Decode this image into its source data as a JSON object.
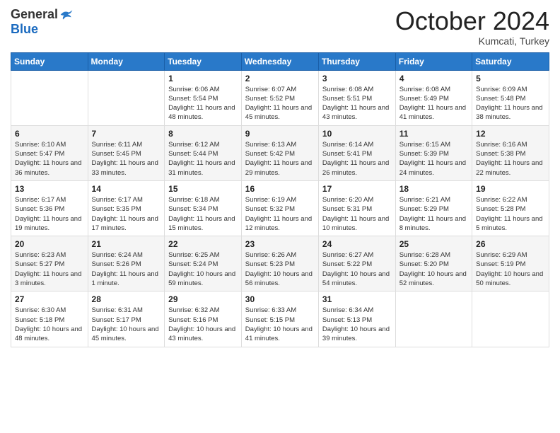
{
  "logo": {
    "general": "General",
    "blue": "Blue"
  },
  "header": {
    "month": "October 2024",
    "location": "Kumcati, Turkey"
  },
  "weekdays": [
    "Sunday",
    "Monday",
    "Tuesday",
    "Wednesday",
    "Thursday",
    "Friday",
    "Saturday"
  ],
  "weeks": [
    [
      {
        "day": null,
        "info": null
      },
      {
        "day": null,
        "info": null
      },
      {
        "day": "1",
        "sunrise": "Sunrise: 6:06 AM",
        "sunset": "Sunset: 5:54 PM",
        "daylight": "Daylight: 11 hours and 48 minutes."
      },
      {
        "day": "2",
        "sunrise": "Sunrise: 6:07 AM",
        "sunset": "Sunset: 5:52 PM",
        "daylight": "Daylight: 11 hours and 45 minutes."
      },
      {
        "day": "3",
        "sunrise": "Sunrise: 6:08 AM",
        "sunset": "Sunset: 5:51 PM",
        "daylight": "Daylight: 11 hours and 43 minutes."
      },
      {
        "day": "4",
        "sunrise": "Sunrise: 6:08 AM",
        "sunset": "Sunset: 5:49 PM",
        "daylight": "Daylight: 11 hours and 41 minutes."
      },
      {
        "day": "5",
        "sunrise": "Sunrise: 6:09 AM",
        "sunset": "Sunset: 5:48 PM",
        "daylight": "Daylight: 11 hours and 38 minutes."
      }
    ],
    [
      {
        "day": "6",
        "sunrise": "Sunrise: 6:10 AM",
        "sunset": "Sunset: 5:47 PM",
        "daylight": "Daylight: 11 hours and 36 minutes."
      },
      {
        "day": "7",
        "sunrise": "Sunrise: 6:11 AM",
        "sunset": "Sunset: 5:45 PM",
        "daylight": "Daylight: 11 hours and 33 minutes."
      },
      {
        "day": "8",
        "sunrise": "Sunrise: 6:12 AM",
        "sunset": "Sunset: 5:44 PM",
        "daylight": "Daylight: 11 hours and 31 minutes."
      },
      {
        "day": "9",
        "sunrise": "Sunrise: 6:13 AM",
        "sunset": "Sunset: 5:42 PM",
        "daylight": "Daylight: 11 hours and 29 minutes."
      },
      {
        "day": "10",
        "sunrise": "Sunrise: 6:14 AM",
        "sunset": "Sunset: 5:41 PM",
        "daylight": "Daylight: 11 hours and 26 minutes."
      },
      {
        "day": "11",
        "sunrise": "Sunrise: 6:15 AM",
        "sunset": "Sunset: 5:39 PM",
        "daylight": "Daylight: 11 hours and 24 minutes."
      },
      {
        "day": "12",
        "sunrise": "Sunrise: 6:16 AM",
        "sunset": "Sunset: 5:38 PM",
        "daylight": "Daylight: 11 hours and 22 minutes."
      }
    ],
    [
      {
        "day": "13",
        "sunrise": "Sunrise: 6:17 AM",
        "sunset": "Sunset: 5:36 PM",
        "daylight": "Daylight: 11 hours and 19 minutes."
      },
      {
        "day": "14",
        "sunrise": "Sunrise: 6:17 AM",
        "sunset": "Sunset: 5:35 PM",
        "daylight": "Daylight: 11 hours and 17 minutes."
      },
      {
        "day": "15",
        "sunrise": "Sunrise: 6:18 AM",
        "sunset": "Sunset: 5:34 PM",
        "daylight": "Daylight: 11 hours and 15 minutes."
      },
      {
        "day": "16",
        "sunrise": "Sunrise: 6:19 AM",
        "sunset": "Sunset: 5:32 PM",
        "daylight": "Daylight: 11 hours and 12 minutes."
      },
      {
        "day": "17",
        "sunrise": "Sunrise: 6:20 AM",
        "sunset": "Sunset: 5:31 PM",
        "daylight": "Daylight: 11 hours and 10 minutes."
      },
      {
        "day": "18",
        "sunrise": "Sunrise: 6:21 AM",
        "sunset": "Sunset: 5:29 PM",
        "daylight": "Daylight: 11 hours and 8 minutes."
      },
      {
        "day": "19",
        "sunrise": "Sunrise: 6:22 AM",
        "sunset": "Sunset: 5:28 PM",
        "daylight": "Daylight: 11 hours and 5 minutes."
      }
    ],
    [
      {
        "day": "20",
        "sunrise": "Sunrise: 6:23 AM",
        "sunset": "Sunset: 5:27 PM",
        "daylight": "Daylight: 11 hours and 3 minutes."
      },
      {
        "day": "21",
        "sunrise": "Sunrise: 6:24 AM",
        "sunset": "Sunset: 5:26 PM",
        "daylight": "Daylight: 11 hours and 1 minute."
      },
      {
        "day": "22",
        "sunrise": "Sunrise: 6:25 AM",
        "sunset": "Sunset: 5:24 PM",
        "daylight": "Daylight: 10 hours and 59 minutes."
      },
      {
        "day": "23",
        "sunrise": "Sunrise: 6:26 AM",
        "sunset": "Sunset: 5:23 PM",
        "daylight": "Daylight: 10 hours and 56 minutes."
      },
      {
        "day": "24",
        "sunrise": "Sunrise: 6:27 AM",
        "sunset": "Sunset: 5:22 PM",
        "daylight": "Daylight: 10 hours and 54 minutes."
      },
      {
        "day": "25",
        "sunrise": "Sunrise: 6:28 AM",
        "sunset": "Sunset: 5:20 PM",
        "daylight": "Daylight: 10 hours and 52 minutes."
      },
      {
        "day": "26",
        "sunrise": "Sunrise: 6:29 AM",
        "sunset": "Sunset: 5:19 PM",
        "daylight": "Daylight: 10 hours and 50 minutes."
      }
    ],
    [
      {
        "day": "27",
        "sunrise": "Sunrise: 6:30 AM",
        "sunset": "Sunset: 5:18 PM",
        "daylight": "Daylight: 10 hours and 48 minutes."
      },
      {
        "day": "28",
        "sunrise": "Sunrise: 6:31 AM",
        "sunset": "Sunset: 5:17 PM",
        "daylight": "Daylight: 10 hours and 45 minutes."
      },
      {
        "day": "29",
        "sunrise": "Sunrise: 6:32 AM",
        "sunset": "Sunset: 5:16 PM",
        "daylight": "Daylight: 10 hours and 43 minutes."
      },
      {
        "day": "30",
        "sunrise": "Sunrise: 6:33 AM",
        "sunset": "Sunset: 5:15 PM",
        "daylight": "Daylight: 10 hours and 41 minutes."
      },
      {
        "day": "31",
        "sunrise": "Sunrise: 6:34 AM",
        "sunset": "Sunset: 5:13 PM",
        "daylight": "Daylight: 10 hours and 39 minutes."
      },
      {
        "day": null,
        "info": null
      },
      {
        "day": null,
        "info": null
      }
    ]
  ]
}
